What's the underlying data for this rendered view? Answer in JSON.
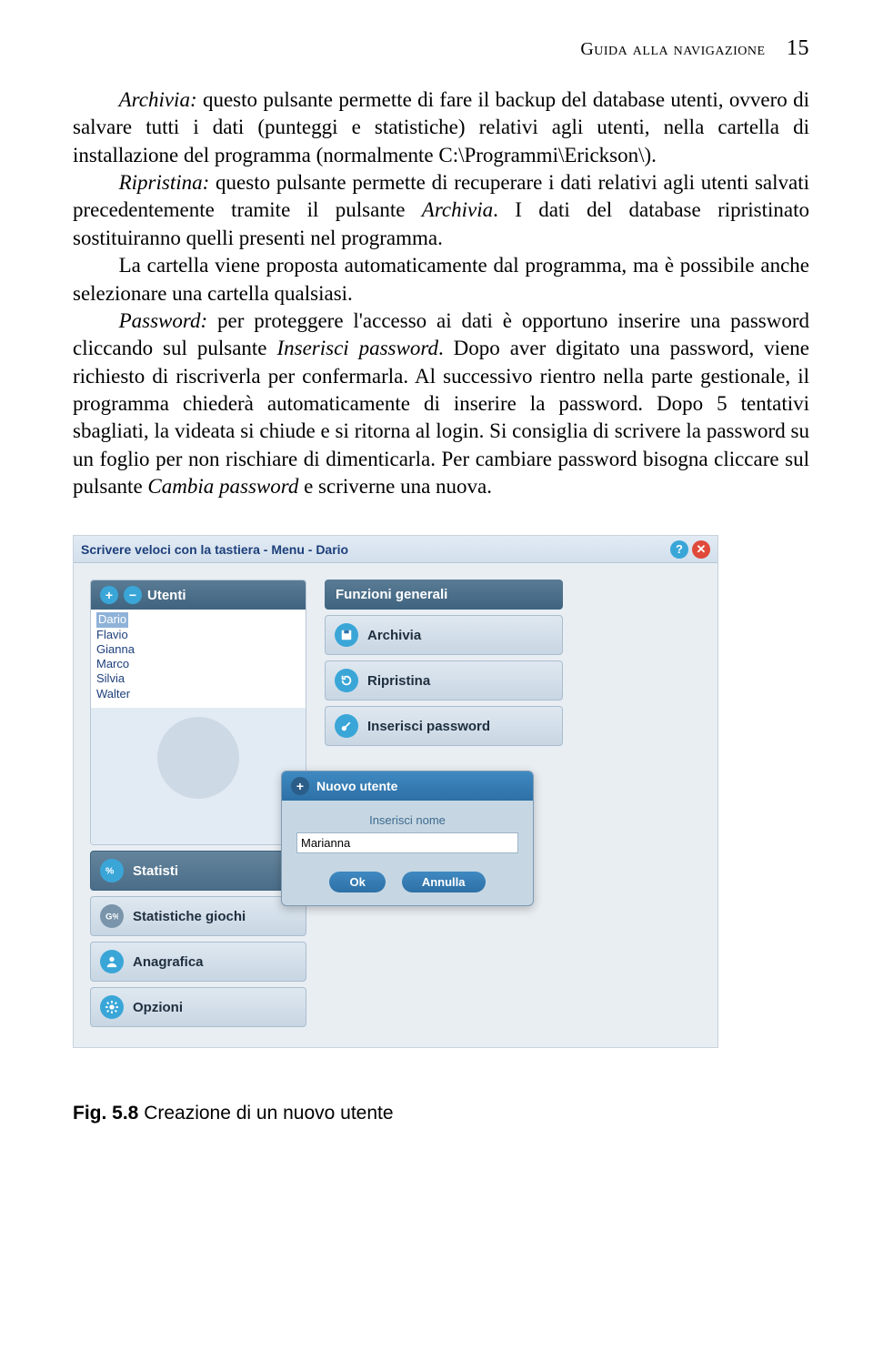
{
  "header": {
    "section": "Guida alla navigazione",
    "page": "15"
  },
  "paragraphs": {
    "p1a": "Archivia:",
    "p1b": " questo pulsante permette di fare il backup del database utenti, ovvero di salvare tutti i dati (punteggi e statistiche) relativi agli utenti, nella cartella di installazione del programma (normalmente C:\\Programmi\\Erickson\\).",
    "p2a": "Ripristina:",
    "p2b": " questo pulsante permette di recuperare i dati relativi agli utenti salvati precedentemente tramite il pulsante ",
    "p2c": "Archivia",
    "p2d": ". I dati del database ripristinato sostituiranno quelli presenti nel programma.",
    "p3": "La cartella viene proposta automaticamente dal programma, ma è possibile anche selezionare una cartella qualsiasi.",
    "p4a": "Password:",
    "p4b": " per proteggere l'accesso ai dati è opportuno inserire una password cliccando sul pulsante ",
    "p4c": "Inserisci password",
    "p4d": ". Dopo aver digitato una password, viene richiesto di riscriverla per confermarla. Al successivo rientro nella parte gestionale, il programma chiederà automaticamente di inserire la password. Dopo 5 tentativi sbagliati, la videata si chiude e si ritorna al login. Si consiglia di scrivere la password su un foglio per non rischiare di dimenticarla. Per cambiare password bisogna cliccare sul pulsante ",
    "p4e": "Cambia password",
    "p4f": " e scriverne una nuova."
  },
  "app": {
    "title": "Scrivere veloci con la tastiera - Menu - Dario",
    "left": {
      "panel_title": "Utenti",
      "users": [
        "Dario",
        "Flavio",
        "Gianna",
        "Marco",
        "Silvia",
        "Walter"
      ],
      "menu": {
        "statistiche": "Statisti",
        "stat_giochi": "Statistiche giochi",
        "anagrafica": "Anagrafica",
        "opzioni": "Opzioni"
      }
    },
    "right": {
      "section_title": "Funzioni generali",
      "archivia": "Archivia",
      "ripristina": "Ripristina",
      "password": "Inserisci password"
    },
    "dialog": {
      "title": "Nuovo utente",
      "label": "Inserisci nome",
      "value": "Marianna",
      "ok": "Ok",
      "cancel": "Annulla"
    }
  },
  "caption": {
    "fig": "Fig. 5.8",
    "text": " Creazione di un nuovo utente"
  }
}
